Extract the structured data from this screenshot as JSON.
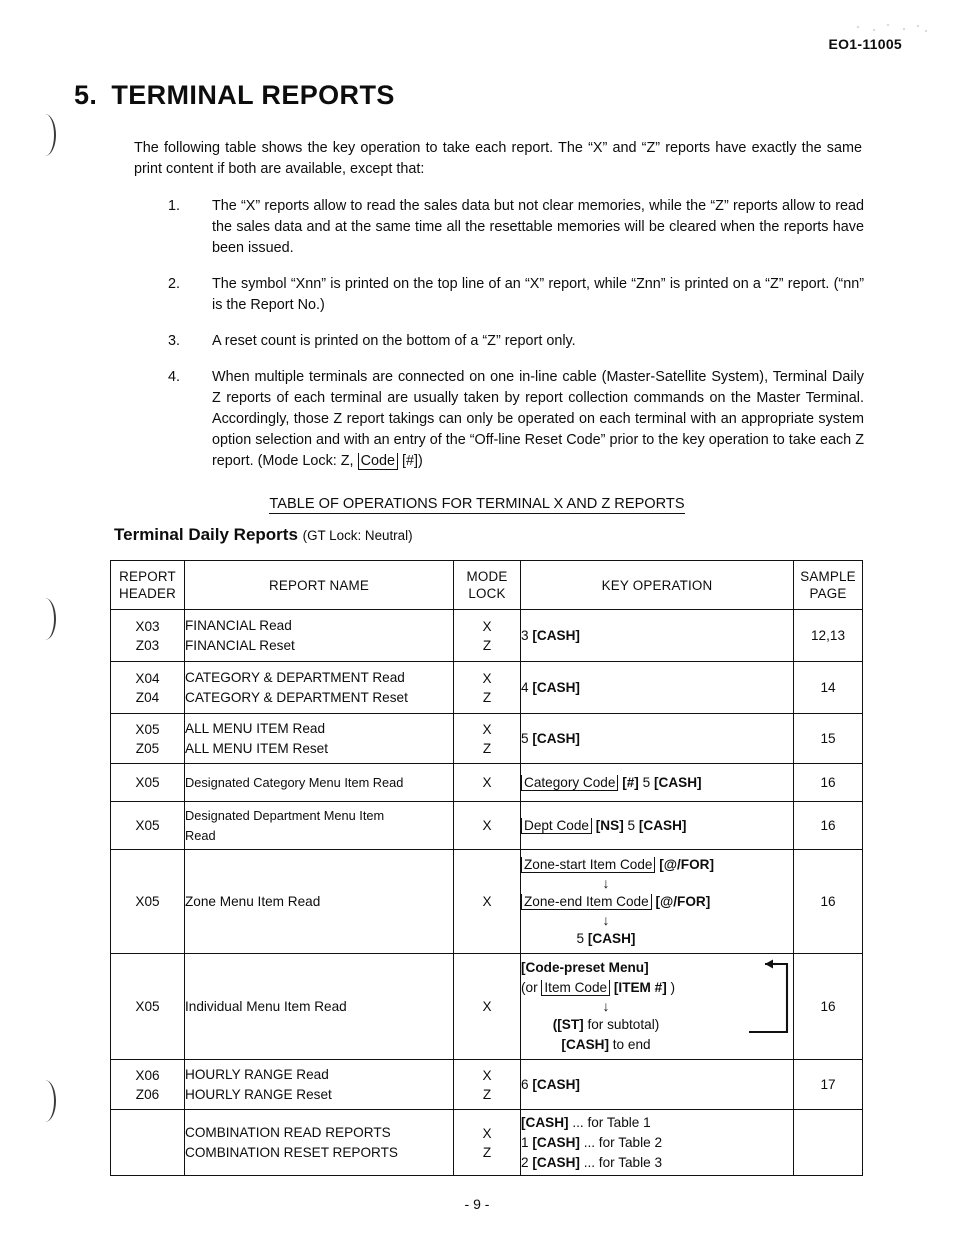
{
  "header": {
    "doc_code": "EO1-11005"
  },
  "title": {
    "number": "5.",
    "text": "TERMINAL REPORTS"
  },
  "intro": "The following table shows the key operation to take each report.  The “X” and “Z” reports have exactly the same print content if both are available, except that:",
  "notes": [
    {
      "num": "1.",
      "text": "The “X” reports allow to read the sales data but not clear memories, while the “Z” reports allow to read the sales data and at the same time all the resettable memories will be cleared when the reports have been issued."
    },
    {
      "num": "2.",
      "text": "The symbol “Xnn” is printed on the top line of an “X” report, while “Znn” is printed on a “Z” report.  (“nn” is the Report No.)"
    },
    {
      "num": "3.",
      "text": "A reset count is printed on the bottom of a “Z” report only."
    },
    {
      "num": "4",
      "text_a": "When multiple terminals are connected on one in-line cable (Master-Satellite System), Terminal Daily Z reports of each terminal are usually taken by report collection commands on the Master Terminal.  Accordingly, those Z report takings can only be operated on each terminal with an appropriate system option selection and with an entry of the “Off-line Reset Code” prior to the key operation to take each Z report.  (Mode Lock: Z,",
      "keybox": "Code",
      "text_b": "[#])",
      "num_label": "4."
    }
  ],
  "table_caption": "TABLE OF OPERATIONS FOR TERMINAL X AND Z REPORTS",
  "subtitle": {
    "main": "Terminal Daily Reports",
    "lock": "(GT Lock: Neutral)"
  },
  "table": {
    "columns": [
      {
        "line1": "REPORT",
        "line2": "HEADER"
      },
      {
        "line1": "REPORT NAME",
        "line2": ""
      },
      {
        "line1": "MODE",
        "line2": "LOCK"
      },
      {
        "line1": "KEY OPERATION",
        "line2": ""
      },
      {
        "line1": "SAMPLE",
        "line2": "PAGE"
      }
    ],
    "rows": [
      {
        "header_l1": "X03",
        "header_l2": "Z03",
        "name_l1": "FINANCIAL Read",
        "name_l2": "FINANCIAL Reset",
        "mode_l1": "X",
        "mode_l2": "Z",
        "key": "3 [CASH]",
        "key_pre": "3 ",
        "key_bold": "[CASH]",
        "page": "12,13"
      },
      {
        "header_l1": "X04",
        "header_l2": "Z04",
        "name_l1": "CATEGORY & DEPARTMENT Read",
        "name_l2": "CATEGORY & DEPARTMENT Reset",
        "mode_l1": "X",
        "mode_l2": "Z",
        "key_pre": "4 ",
        "key_bold": "[CASH]",
        "page": "14"
      },
      {
        "header_l1": "X05",
        "header_l2": "Z05",
        "name_l1": "ALL MENU ITEM Read",
        "name_l2": "ALL MENU ITEM Reset",
        "mode_l1": "X",
        "mode_l2": "Z",
        "key_pre": "5 ",
        "key_bold": "[CASH]",
        "page": "15"
      },
      {
        "header_l1": "X05",
        "header_l2": "",
        "name_l1": "Designated Category Menu Item Read",
        "name_l2": "",
        "mode_l1": "X",
        "mode_l2": "",
        "key_box": "Category Code",
        "key_bold": "[#]",
        "key_mid": " 5 ",
        "key_bold2": "[CASH]",
        "page": "16"
      },
      {
        "header_l1": "X05",
        "header_l2": "",
        "name_l1": "Designated Department Menu Item",
        "name_l2": "Read",
        "mode_l1": "X",
        "mode_l2": "",
        "key_box": "Dept Code",
        "key_bold": "[NS]",
        "key_mid": " 5 ",
        "key_bold2": "[CASH]",
        "page": "16"
      },
      {
        "header_l1": "X05",
        "header_l2": "",
        "name_l1": "Zone Menu Item Read",
        "name_l2": "",
        "mode_l1": "X",
        "mode_l2": "",
        "key_line1_box": "Zone-start Item Code",
        "key_line1_bold": "[@/FOR]",
        "key_line2_box": "Zone-end Item Code",
        "key_line2_bold": "[@/FOR]",
        "key_line3_pre": "5 ",
        "key_line3_bold": "[CASH]",
        "arrow": "↓",
        "page": "16"
      },
      {
        "header_l1": "X05",
        "header_l2": "",
        "name_l1": "Individual Menu Item Read",
        "name_l2": "",
        "mode_l1": "X",
        "mode_l2": "",
        "key_line1_bold": "[Code-preset Menu]",
        "key_line2_pre": "(or ",
        "key_line2_box": "Item Code",
        "key_line2_bold": " [ITEM #]",
        "key_line2_post": " )",
        "arrow": "↓",
        "key_line3_bold": "([ST]",
        "key_line3_post": " for subtotal)",
        "key_line4_bold": "[CASH]",
        "key_line4_post": " to end",
        "page": "16"
      },
      {
        "header_l1": "X06",
        "header_l2": "Z06",
        "name_l1": "HOURLY RANGE Read",
        "name_l2": "HOURLY RANGE Reset",
        "mode_l1": "X",
        "mode_l2": "Z",
        "key_pre": "6   ",
        "key_bold": "[CASH]",
        "page": "17"
      },
      {
        "header_l1": "",
        "header_l2": "",
        "name_l1": "COMBINATION READ REPORTS",
        "name_l2": "COMBINATION RESET REPORTS",
        "mode_l1": "X",
        "mode_l2": "Z",
        "key_c1_bold": "[CASH]",
        "key_c1_post": " ... for Table 1",
        "key_c2_pre": "1 ",
        "key_c2_bold": "[CASH]",
        "key_c2_post": " ... for Table 2",
        "key_c3_pre": "2 ",
        "key_c3_bold": "[CASH]",
        "key_c3_post": " ... for Table 3",
        "page": ""
      }
    ]
  },
  "footer": {
    "page_number": "- 9 -"
  }
}
